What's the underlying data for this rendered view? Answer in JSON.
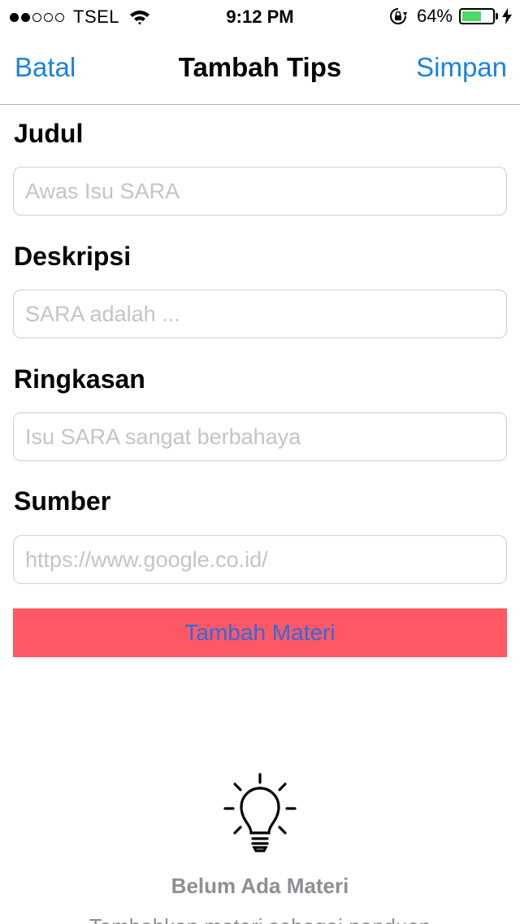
{
  "status_bar": {
    "carrier": "TSEL",
    "signal_bars_filled": 2,
    "signal_bars_total": 5,
    "time": "9:12 PM",
    "battery_percent": "64%",
    "battery_level": 0.64,
    "battery_color": "#4cd964",
    "icons": [
      "wifi-icon",
      "rotation-lock-icon",
      "charging-bolt-icon"
    ]
  },
  "nav": {
    "cancel_label": "Batal",
    "title": "Tambah Tips",
    "save_label": "Simpan",
    "accent_color": "#1a82e0"
  },
  "form": {
    "title_field": {
      "label": "Judul",
      "value": "",
      "placeholder": "Awas Isu SARA"
    },
    "description_field": {
      "label": "Deskripsi",
      "value": "",
      "placeholder": "SARA adalah ..."
    },
    "summary_field": {
      "label": "Ringkasan",
      "value": "",
      "placeholder": "Isu SARA sangat berbahaya"
    },
    "source_field": {
      "label": "Sumber",
      "value": "",
      "placeholder": "https://www.google.co.id/"
    },
    "add_material_button": {
      "label": "Tambah Materi",
      "background": "#ff5865",
      "text_color": "#2c6be0"
    }
  },
  "empty_state": {
    "icon": "lightbulb-icon",
    "title": "Belum Ada Materi",
    "subtitle": "Tambahkan materi sebagai panduan"
  }
}
